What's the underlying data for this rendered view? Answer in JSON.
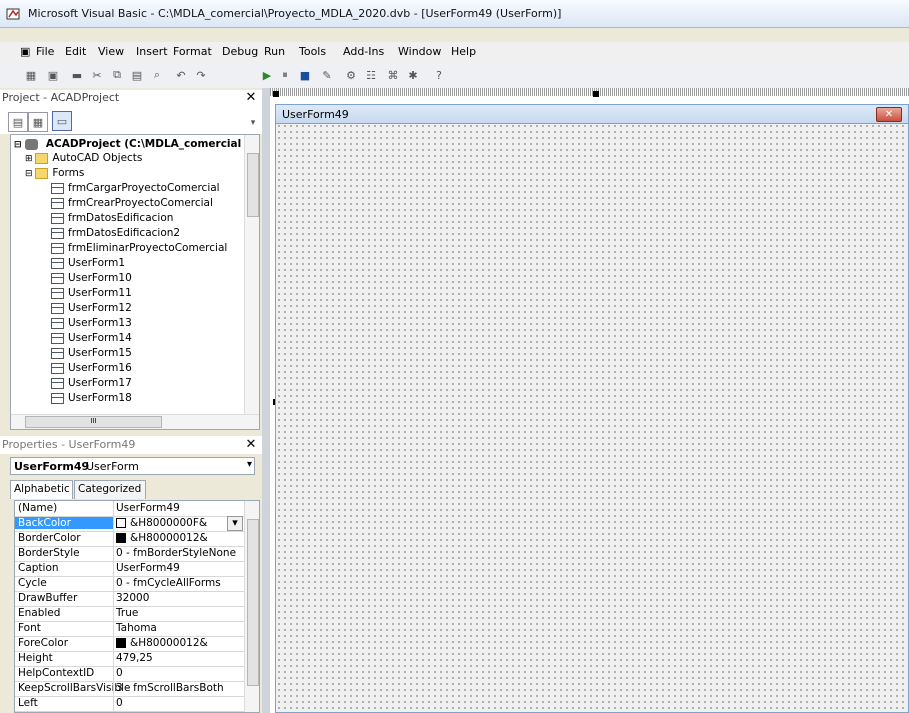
{
  "window": {
    "title": "Microsoft Visual Basic - C:\\MDLA_comercial\\Proyecto_MDLA_2020.dvb - [UserForm49 (UserForm)]"
  },
  "menu": {
    "items": [
      "File",
      "Edit",
      "View",
      "Insert",
      "Format",
      "Debug",
      "Run",
      "Tools",
      "Add-Ins",
      "Window",
      "Help"
    ]
  },
  "toolbar": {
    "icons": [
      "view-host-icon",
      "insert-userform-icon",
      "save-icon",
      "cut-icon",
      "copy-icon",
      "paste-icon",
      "find-icon",
      "undo-icon",
      "redo-icon",
      "run-icon",
      "break-icon",
      "reset-icon",
      "design-mode-icon",
      "project-explorer-icon",
      "properties-icon",
      "object-browser-icon",
      "toolbox-icon",
      "help-icon"
    ]
  },
  "project": {
    "panel_title": "Project - ACADProject",
    "root": "ACADProject (C:\\MDLA_comercial",
    "nodes": [
      {
        "label": "AutoCAD Objects",
        "type": "folder",
        "level": 1
      },
      {
        "label": "Forms",
        "type": "folder-open",
        "level": 1
      },
      {
        "label": "frmCargarProyectoComercial",
        "type": "form",
        "level": 2
      },
      {
        "label": "frmCrearProyectoComercial",
        "type": "form",
        "level": 2
      },
      {
        "label": "frmDatosEdificacion",
        "type": "form",
        "level": 2
      },
      {
        "label": "frmDatosEdificacion2",
        "type": "form",
        "level": 2
      },
      {
        "label": "frmEliminarProyectoComercial",
        "type": "form",
        "level": 2
      },
      {
        "label": "UserForm1",
        "type": "form",
        "level": 2
      },
      {
        "label": "UserForm10",
        "type": "form",
        "level": 2
      },
      {
        "label": "UserForm11",
        "type": "form",
        "level": 2
      },
      {
        "label": "UserForm12",
        "type": "form",
        "level": 2
      },
      {
        "label": "UserForm13",
        "type": "form",
        "level": 2
      },
      {
        "label": "UserForm14",
        "type": "form",
        "level": 2
      },
      {
        "label": "UserForm15",
        "type": "form",
        "level": 2
      },
      {
        "label": "UserForm16",
        "type": "form",
        "level": 2
      },
      {
        "label": "UserForm17",
        "type": "form",
        "level": 2
      },
      {
        "label": "UserForm18",
        "type": "form",
        "level": 2
      }
    ],
    "hscroll_label": "III"
  },
  "properties": {
    "panel_title": "Properties - UserForm49",
    "object_name": "UserForm49",
    "object_type": "UserForm",
    "tabs": [
      "Alphabetic",
      "Categorized"
    ],
    "rows": [
      {
        "key": "(Name)",
        "value": "UserForm49"
      },
      {
        "key": "BackColor",
        "value": "&H8000000F&",
        "swatch": "#ffffff",
        "selected": true
      },
      {
        "key": "BorderColor",
        "value": "&H80000012&",
        "swatch": "#000000"
      },
      {
        "key": "BorderStyle",
        "value": "0 - fmBorderStyleNone"
      },
      {
        "key": "Caption",
        "value": "UserForm49"
      },
      {
        "key": "Cycle",
        "value": "0 - fmCycleAllForms"
      },
      {
        "key": "DrawBuffer",
        "value": "32000"
      },
      {
        "key": "Enabled",
        "value": "True"
      },
      {
        "key": "Font",
        "value": "Tahoma"
      },
      {
        "key": "ForeColor",
        "value": "&H80000012&",
        "swatch": "#000000"
      },
      {
        "key": "Height",
        "value": "479,25"
      },
      {
        "key": "HelpContextID",
        "value": "0"
      },
      {
        "key": "KeepScrollBarsVisible",
        "value": "3 - fmScrollBarsBoth"
      },
      {
        "key": "Left",
        "value": "0"
      }
    ]
  },
  "designer": {
    "form_caption": "UserForm49"
  },
  "colors": {
    "selection": "#3399ff",
    "form_caption_start": "#dde9f7",
    "close_button": "#c75040"
  }
}
